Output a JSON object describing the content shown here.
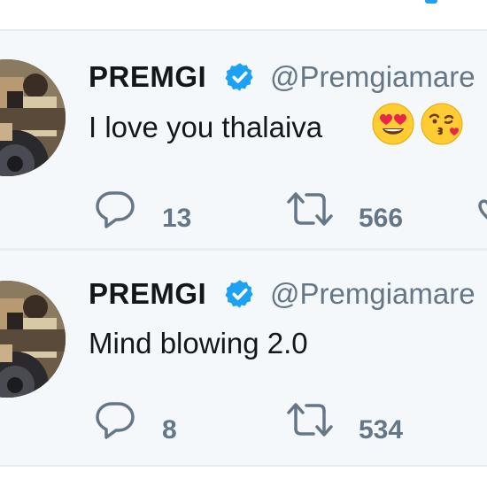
{
  "tweets": [
    {
      "display_name": "PREMGI",
      "handle": "@Premgiamare",
      "text": "I love you thalaiva",
      "emojis": [
        "heart-eyes-emoji",
        "kissing-face-emoji"
      ],
      "reply_count": "13",
      "retweet_count": "566"
    },
    {
      "display_name": "PREMGI",
      "handle": "@Premgiamare",
      "text": "Mind blowing 2.0",
      "emojis": [],
      "reply_count": "8",
      "retweet_count": "534"
    }
  ],
  "colors": {
    "accent": "#1da1f2",
    "text": "#14171a",
    "secondary": "#657786",
    "tweet_bg": "#f5f8fa",
    "divider": "#e6ecf0"
  },
  "icons": {
    "verified": "verified-badge-icon",
    "reply": "reply-icon",
    "retweet": "retweet-icon"
  }
}
